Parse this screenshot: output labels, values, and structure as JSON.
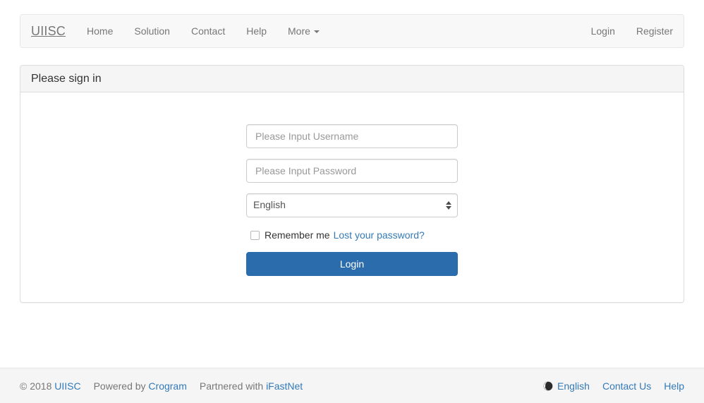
{
  "navbar": {
    "brand": "UIISC",
    "left_items": [
      {
        "label": "Home"
      },
      {
        "label": "Solution"
      },
      {
        "label": "Contact"
      },
      {
        "label": "Help"
      },
      {
        "label": "More",
        "has_caret": true
      }
    ],
    "right_items": [
      {
        "label": "Login"
      },
      {
        "label": "Register"
      }
    ]
  },
  "panel": {
    "title": "Please sign in"
  },
  "form": {
    "username": {
      "value": "",
      "placeholder": "Please Input Username"
    },
    "password": {
      "value": "",
      "placeholder": "Please Input Password"
    },
    "language": {
      "selected": "English",
      "options": [
        "English"
      ]
    },
    "remember_me": {
      "label": "Remember me",
      "checked": false
    },
    "lost_password_link": "Lost your password?",
    "submit_label": "Login"
  },
  "footer": {
    "copyright": "© 2018",
    "copyright_link": "UIISC",
    "powered_by_text": "Powered by",
    "powered_by_link": "Crogram",
    "partnered_text": "Partnered with",
    "partnered_link": "iFastNet",
    "language": "English",
    "contact_us": "Contact Us",
    "help": "Help"
  },
  "colors": {
    "primary": "#2b6cac",
    "link": "#337ab7",
    "nav_text": "#777777",
    "navbar_bg": "#f8f8f8",
    "panel_heading_bg": "#f5f5f5",
    "footer_bg": "#f5f5f5"
  }
}
